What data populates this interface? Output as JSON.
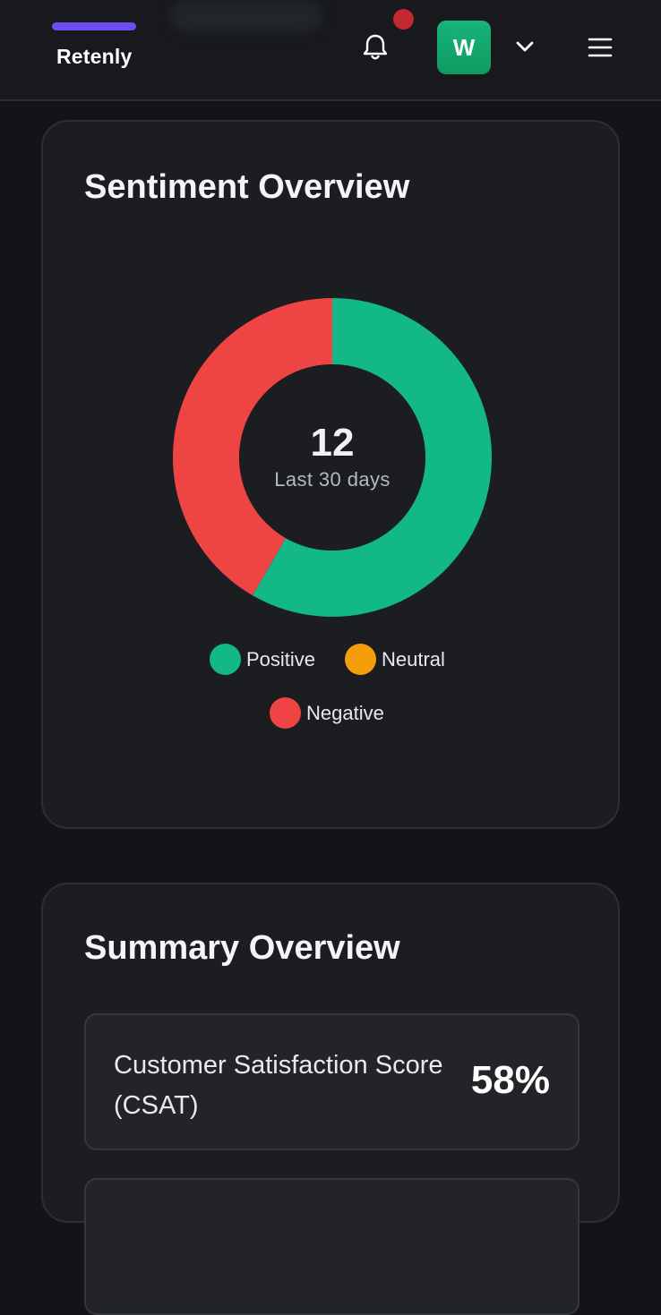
{
  "header": {
    "brand": "Retenly",
    "avatar_initial": "W",
    "icons": {
      "notifications": "bell-icon",
      "account_menu": "chevron-down-icon",
      "main_menu": "hamburger-menu-icon"
    },
    "colors": {
      "brand_accent": "#6d4cf0",
      "avatar": "#12a870",
      "notification_badge": "#c2282f"
    }
  },
  "sentiment": {
    "title": "Sentiment Overview",
    "total": "12",
    "period": "Last 30 days",
    "legend": [
      {
        "label": "Positive",
        "color": "#12b886"
      },
      {
        "label": "Neutral",
        "color": "#f59e0b"
      },
      {
        "label": "Negative",
        "color": "#ef4444"
      }
    ]
  },
  "chart_data": {
    "type": "pie",
    "donut": true,
    "categories": [
      "Positive",
      "Neutral",
      "Negative"
    ],
    "values": [
      7,
      0,
      5
    ],
    "colors": [
      "#12b886",
      "#f59e0b",
      "#ef4444"
    ],
    "center_value": "12",
    "center_label": "Last 30 days",
    "legend_position": "bottom"
  },
  "summary": {
    "title": "Summary Overview",
    "metrics": [
      {
        "label": "Customer Satisfaction Score (CSAT)",
        "value": "58%"
      }
    ]
  }
}
